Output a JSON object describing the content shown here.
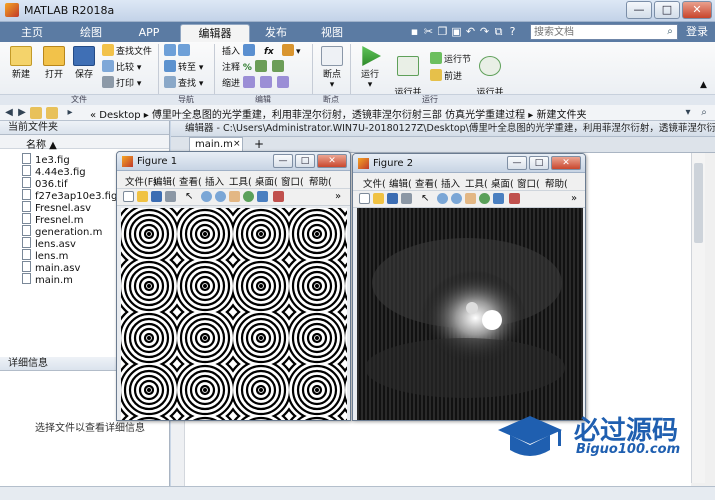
{
  "window": {
    "title": "MATLAB R2018a",
    "min": "—",
    "max": "□",
    "close": "✕"
  },
  "tabs": [
    {
      "label": "主页"
    },
    {
      "label": "绘图"
    },
    {
      "label": "APP"
    },
    {
      "label": "编辑器",
      "active": true
    },
    {
      "label": "发布"
    },
    {
      "label": "视图"
    }
  ],
  "search": {
    "placeholder": "搜索文档"
  },
  "login": "登录",
  "ribbon": {
    "file": {
      "new": "新建",
      "open": "打开",
      "save": "保存",
      "find_files": "查找文件",
      "compare": "比较",
      "print": "打印",
      "group": "文件"
    },
    "nav": {
      "goto": "转至",
      "find": "查找",
      "group": "导航"
    },
    "edit": {
      "insert": "插入",
      "comment": "注释",
      "indent": "缩进",
      "group": "编辑",
      "fx": "fx"
    },
    "breakpoints": {
      "label": "断点",
      "group": "断点"
    },
    "run": {
      "run": "运行",
      "run_advance": "运行并\n前进",
      "run_section": "运行节",
      "advance": "前进",
      "run_time": "运行并\n计时",
      "group": "运行"
    }
  },
  "address": {
    "path": "« Desktop ▸ 傅里叶全息图的光学重建，利用菲涅尔衍射，透镜菲涅尔衍射三部 仿真光学重建过程 ▸ 新建文件夹"
  },
  "current_folder": {
    "title": "当前文件夹",
    "column": "名称 ▲",
    "files": [
      "1e3.fig",
      "4.44e3.fig",
      "036.tif",
      "f27e3ap10e3.fig",
      "Fresnel.asv",
      "Fresnel.m",
      "generation.m",
      "lens.asv",
      "lens.m",
      "main.asv",
      "main.m"
    ]
  },
  "details": {
    "title": "详细信息",
    "hint": "选择文件以查看详细信息"
  },
  "editor": {
    "title": "编辑器 - C:\\Users\\Administrator.WIN7U-20180127Z\\Desktop\\傅里叶全息图的光学重建，利用菲涅尔衍射，透镜菲涅尔衍",
    "tab": "main.m",
    "add_tab": "+"
  },
  "figures": [
    {
      "title": "Figure 1",
      "menu": [
        "文件(F)",
        "编辑(",
        "查看(",
        "插入",
        "工具(",
        "桌面(",
        "窗口(",
        "帮助("
      ]
    },
    {
      "title": "Figure 2",
      "menu": [
        "文件(",
        "编辑(",
        "查看(",
        "插入",
        "工具(",
        "桌面(",
        "窗口(",
        "帮助("
      ]
    }
  ],
  "watermark": {
    "brand": "必过源码",
    "url": "Biguo100.com"
  },
  "colors": {
    "tab_bar": "#5b7ba3",
    "accent": "#3b6fb6",
    "watermark_blue": "#1f5fb0"
  }
}
